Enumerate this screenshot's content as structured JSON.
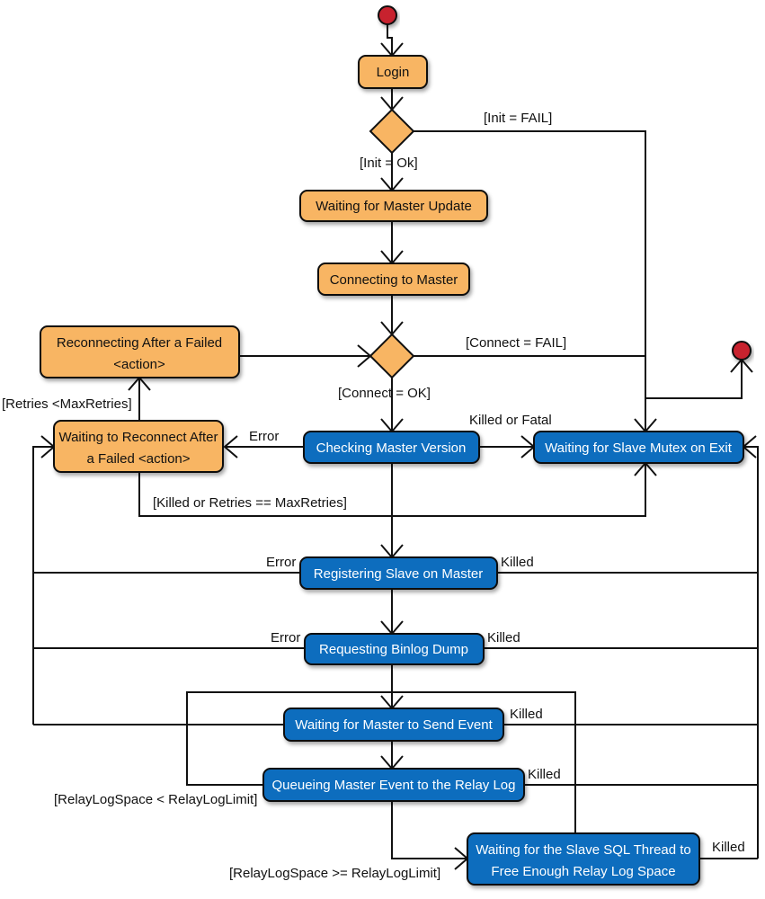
{
  "diagram": {
    "type": "state-diagram",
    "colors": {
      "orange_fill": "#F8B563",
      "blue_fill": "#0B6DBE",
      "terminal_fill": "#C8232F",
      "line": "#111111",
      "orange_text": "#111111",
      "blue_text": "#FFFFFF"
    },
    "nodes": {
      "login": "Login",
      "waiting_master_update": "Waiting for Master Update",
      "connecting_master": "Connecting to Master",
      "reconnecting_failed": [
        "Reconnecting After a Failed",
        "<action>"
      ],
      "waiting_reconnect": [
        "Waiting to Reconnect After",
        "a Failed <action>"
      ],
      "checking_master_version": "Checking Master Version",
      "waiting_slave_mutex": "Waiting for Slave Mutex on Exit",
      "registering_slave": "Registering Slave on Master",
      "requesting_binlog": "Requesting Binlog Dump",
      "waiting_master_send": "Waiting for Master to Send Event",
      "queueing_master_event": "Queueing Master Event to the Relay Log",
      "waiting_sql_thread": [
        "Waiting for the Slave SQL Thread to",
        "Free Enough Relay Log Space"
      ]
    },
    "labels": {
      "init_fail": "[Init =  FAIL]",
      "init_ok": "[Init = Ok]",
      "connect_fail": "[Connect =  FAIL]",
      "connect_ok": "[Connect = OK]",
      "retries_lt": "[Retries <MaxRetries]",
      "error_checking": "Error",
      "killed_or_fatal": "Killed or  Fatal",
      "killed_or_retries": "[Killed or  Retries == MaxRetries]",
      "error_registering": "Error",
      "killed_registering": "Killed",
      "error_requesting": "Error",
      "killed_requesting": "Killed",
      "killed_waiting_send": "Killed",
      "killed_queueing": "Killed",
      "relay_lt": "[RelayLogSpace < RelayLogLimit]",
      "relay_ge": "[RelayLogSpace >=  RelayLogLimit]",
      "killed_sql_thread": "Killed"
    },
    "transitions": [
      {
        "from": "start",
        "to": "login"
      },
      {
        "from": "login",
        "to": "decision_init"
      },
      {
        "from": "decision_init",
        "to": "waiting_master_update",
        "guard": "[Init = Ok]"
      },
      {
        "from": "decision_init",
        "to": "waiting_slave_mutex",
        "guard": "[Init =  FAIL]"
      },
      {
        "from": "waiting_master_update",
        "to": "connecting_master"
      },
      {
        "from": "connecting_master",
        "to": "decision_connect"
      },
      {
        "from": "reconnecting_failed",
        "to": "decision_connect"
      },
      {
        "from": "decision_connect",
        "to": "checking_master_version",
        "guard": "[Connect = OK]"
      },
      {
        "from": "decision_connect",
        "to": "waiting_slave_mutex",
        "guard": "[Connect =  FAIL]"
      },
      {
        "from": "waiting_reconnect",
        "to": "reconnecting_failed",
        "guard": "[Retries <MaxRetries]"
      },
      {
        "from": "checking_master_version",
        "to": "waiting_reconnect",
        "guard": "Error"
      },
      {
        "from": "checking_master_version",
        "to": "waiting_slave_mutex",
        "guard": "Killed or  Fatal"
      },
      {
        "from": "waiting_reconnect",
        "to": "waiting_slave_mutex",
        "guard": "[Killed or  Retries == MaxRetries]"
      },
      {
        "from": "checking_master_version",
        "to": "registering_slave"
      },
      {
        "from": "registering_slave",
        "to": "waiting_reconnect",
        "guard": "Error"
      },
      {
        "from": "registering_slave",
        "to": "waiting_slave_mutex",
        "guard": "Killed"
      },
      {
        "from": "registering_slave",
        "to": "requesting_binlog"
      },
      {
        "from": "requesting_binlog",
        "to": "waiting_reconnect",
        "guard": "Error"
      },
      {
        "from": "requesting_binlog",
        "to": "waiting_slave_mutex",
        "guard": "Killed"
      },
      {
        "from": "requesting_binlog",
        "to": "waiting_master_send"
      },
      {
        "from": "waiting_master_send",
        "to": "waiting_reconnect"
      },
      {
        "from": "waiting_master_send",
        "to": "waiting_slave_mutex",
        "guard": "Killed"
      },
      {
        "from": "waiting_master_send",
        "to": "queueing_master_event"
      },
      {
        "from": "queueing_master_event",
        "to": "waiting_master_send",
        "guard": "[RelayLogSpace < RelayLogLimit]"
      },
      {
        "from": "queueing_master_event",
        "to": "waiting_sql_thread",
        "guard": "[RelayLogSpace >=  RelayLogLimit]"
      },
      {
        "from": "queueing_master_event",
        "to": "waiting_slave_mutex",
        "guard": "Killed"
      },
      {
        "from": "waiting_sql_thread",
        "to": "waiting_master_send"
      },
      {
        "from": "waiting_sql_thread",
        "to": "waiting_slave_mutex",
        "guard": "Killed"
      },
      {
        "from": "waiting_slave_mutex",
        "to": "end"
      }
    ]
  }
}
